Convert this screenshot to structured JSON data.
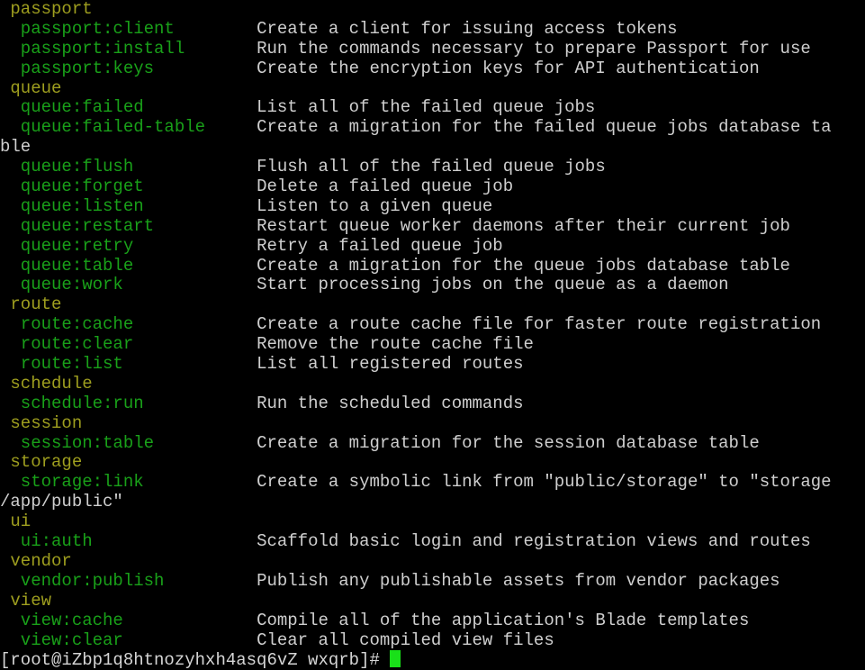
{
  "terminal": {
    "background": "#000000",
    "colors": {
      "section_header": "#9e9e1f",
      "command": "#19a019",
      "description": "#cfcfcf",
      "prompt": "#d5d5d5",
      "cursor": "#19e019"
    },
    "prompt_line": "[root@iZbp1q8htnozyhxh4asq6vZ wxqrb]# ",
    "cursor_glyph": "block-cursor",
    "lines": [
      {
        "type": "section",
        "text": " passport"
      },
      {
        "type": "command",
        "name": "  passport:client",
        "pad": "        ",
        "desc": "Create a client for issuing access tokens"
      },
      {
        "type": "command",
        "name": "  passport:install",
        "pad": "       ",
        "desc": "Run the commands necessary to prepare Passport for use"
      },
      {
        "type": "command",
        "name": "  passport:keys",
        "pad": "          ",
        "desc": "Create the encryption keys for API authentication"
      },
      {
        "type": "section",
        "text": " queue"
      },
      {
        "type": "command",
        "name": "  queue:failed",
        "pad": "           ",
        "desc": "List all of the failed queue jobs"
      },
      {
        "type": "command",
        "name": "  queue:failed-table",
        "pad": "     ",
        "desc": "Create a migration for the failed queue jobs database ta"
      },
      {
        "type": "wrap",
        "text": "ble"
      },
      {
        "type": "command",
        "name": "  queue:flush",
        "pad": "            ",
        "desc": "Flush all of the failed queue jobs"
      },
      {
        "type": "command",
        "name": "  queue:forget",
        "pad": "           ",
        "desc": "Delete a failed queue job"
      },
      {
        "type": "command",
        "name": "  queue:listen",
        "pad": "           ",
        "desc": "Listen to a given queue"
      },
      {
        "type": "command",
        "name": "  queue:restart",
        "pad": "          ",
        "desc": "Restart queue worker daemons after their current job"
      },
      {
        "type": "command",
        "name": "  queue:retry",
        "pad": "            ",
        "desc": "Retry a failed queue job"
      },
      {
        "type": "command",
        "name": "  queue:table",
        "pad": "            ",
        "desc": "Create a migration for the queue jobs database table"
      },
      {
        "type": "command",
        "name": "  queue:work",
        "pad": "             ",
        "desc": "Start processing jobs on the queue as a daemon"
      },
      {
        "type": "section",
        "text": " route"
      },
      {
        "type": "command",
        "name": "  route:cache",
        "pad": "            ",
        "desc": "Create a route cache file for faster route registration"
      },
      {
        "type": "command",
        "name": "  route:clear",
        "pad": "            ",
        "desc": "Remove the route cache file"
      },
      {
        "type": "command",
        "name": "  route:list",
        "pad": "             ",
        "desc": "List all registered routes"
      },
      {
        "type": "section",
        "text": " schedule"
      },
      {
        "type": "command",
        "name": "  schedule:run",
        "pad": "           ",
        "desc": "Run the scheduled commands"
      },
      {
        "type": "section",
        "text": " session"
      },
      {
        "type": "command",
        "name": "  session:table",
        "pad": "          ",
        "desc": "Create a migration for the session database table"
      },
      {
        "type": "section",
        "text": " storage"
      },
      {
        "type": "command",
        "name": "  storage:link",
        "pad": "           ",
        "desc": "Create a symbolic link from \"public/storage\" to \"storage"
      },
      {
        "type": "wrap",
        "text": "/app/public\""
      },
      {
        "type": "section",
        "text": " ui"
      },
      {
        "type": "command",
        "name": "  ui:auth",
        "pad": "                ",
        "desc": "Scaffold basic login and registration views and routes"
      },
      {
        "type": "section",
        "text": " vendor"
      },
      {
        "type": "command",
        "name": "  vendor:publish",
        "pad": "         ",
        "desc": "Publish any publishable assets from vendor packages"
      },
      {
        "type": "section",
        "text": " view"
      },
      {
        "type": "command",
        "name": "  view:cache",
        "pad": "             ",
        "desc": "Compile all of the application's Blade templates"
      },
      {
        "type": "command",
        "name": "  view:clear",
        "pad": "             ",
        "desc": "Clear all compiled view files"
      }
    ]
  }
}
